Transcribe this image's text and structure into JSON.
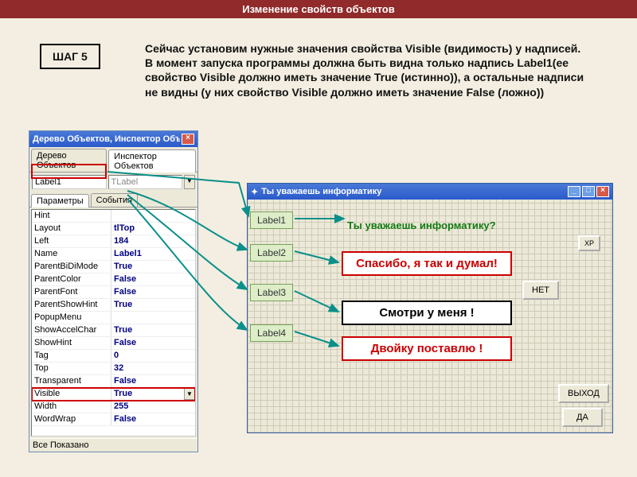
{
  "topbar": "Изменение свойств объектов",
  "step": "ШАГ 5",
  "maintext": "Сейчас установим нужные значения свойства Visible (видимость) у надписей. В момент запуска программы должна быть видна только надпись Label1(ее свойство Visible должно иметь значение True (истинно)), а остальные надписи не видны (у них свойство Visible должно иметь значение False (ложно))",
  "inspector": {
    "title": "Дерево Объектов, Инспектор Объ...",
    "tab1": "Дерево Объектов",
    "tab2": "Инспектор Объектов",
    "combo_name": "Label1",
    "combo_type": "TLabel",
    "tab_params": "Параметры",
    "tab_events": "События",
    "props": [
      {
        "k": "Hint",
        "v": "",
        "plain": true
      },
      {
        "k": "Layout",
        "v": "tlTop"
      },
      {
        "k": "Left",
        "v": "184"
      },
      {
        "k": "Name",
        "v": "Label1"
      },
      {
        "k": "ParentBiDiMode",
        "v": "True"
      },
      {
        "k": "ParentColor",
        "v": "False"
      },
      {
        "k": "ParentFont",
        "v": "False"
      },
      {
        "k": "ParentShowHint",
        "v": "True"
      },
      {
        "k": "PopupMenu",
        "v": "",
        "plain": true
      },
      {
        "k": "ShowAccelChar",
        "v": "True"
      },
      {
        "k": "ShowHint",
        "v": "False"
      },
      {
        "k": "Tag",
        "v": "0"
      },
      {
        "k": "Top",
        "v": "32"
      },
      {
        "k": "Transparent",
        "v": "False"
      }
    ],
    "sel": {
      "k": "Visible",
      "v": "True"
    },
    "after": [
      {
        "k": "Width",
        "v": "255"
      },
      {
        "k": "WordWrap",
        "v": "False"
      }
    ],
    "status": "Все Показано"
  },
  "form": {
    "title": "Ты уважаешь информатику",
    "question": "Ты уважаешь информатику?",
    "xp": "XP",
    "callouts": [
      "Label1",
      "Label2",
      "Label3",
      "Label4"
    ],
    "msg1": "Спасибо, я так и думал!",
    "msg2": "Смотри у меня !",
    "msg3": "Двойку поставлю !",
    "btn_no": "НЕТ",
    "btn_exit": "ВЫХОД",
    "btn_yes": "ДА"
  }
}
